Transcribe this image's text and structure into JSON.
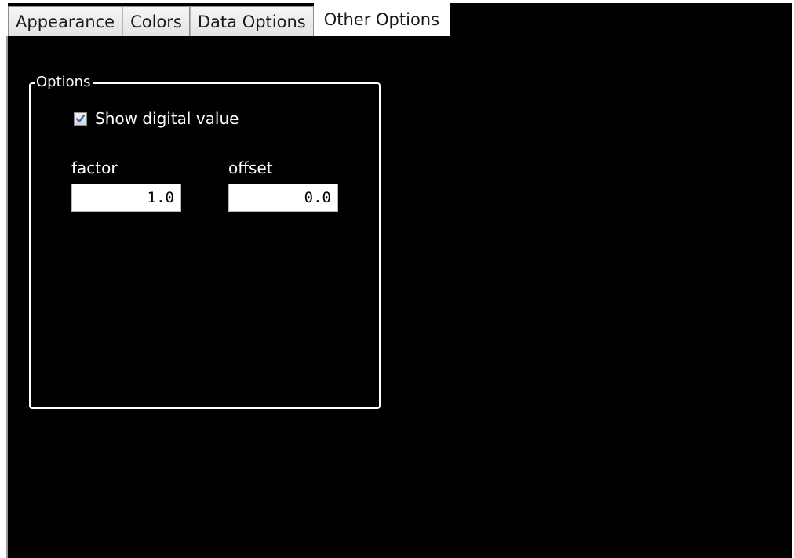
{
  "tabs": [
    {
      "label": "Appearance",
      "active": false
    },
    {
      "label": "Colors",
      "active": false
    },
    {
      "label": "Data Options",
      "active": false
    },
    {
      "label": "Other Options",
      "active": true
    }
  ],
  "options_group": {
    "title": "Options",
    "show_digital_value": {
      "label": "Show digital value",
      "checked": true
    },
    "factor": {
      "label": "factor",
      "value": "1.0"
    },
    "offset": {
      "label": "offset",
      "value": "0.0"
    }
  },
  "colors": {
    "panel_background": "#000000",
    "text": "#ffffff",
    "checkbox_mark": "#3c6fb5"
  }
}
